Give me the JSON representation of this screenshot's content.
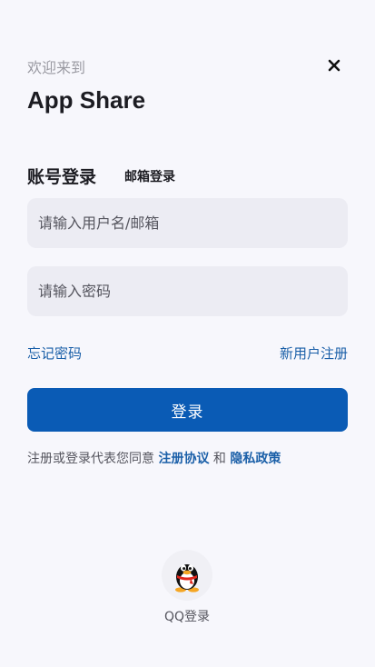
{
  "header": {
    "welcome": "欢迎来到",
    "app_name": "App Share"
  },
  "tabs": {
    "account_login": "账号登录",
    "email_login": "邮箱登录"
  },
  "form": {
    "username_placeholder": "请输入用户名/邮箱",
    "password_placeholder": "请输入密码"
  },
  "links": {
    "forgot_password": "忘记密码",
    "new_user_register": "新用户注册"
  },
  "login_button": "登录",
  "agreement": {
    "prefix": "注册或登录代表您同意",
    "terms": "注册协议",
    "and": "和",
    "privacy": "隐私政策"
  },
  "social": {
    "qq_label": "QQ登录",
    "icon": "qq-penguin-icon"
  },
  "colors": {
    "background": "#f7f7fc",
    "primary": "#0a5bb5",
    "link": "#1a5fa8",
    "input_bg": "#ececf3"
  }
}
